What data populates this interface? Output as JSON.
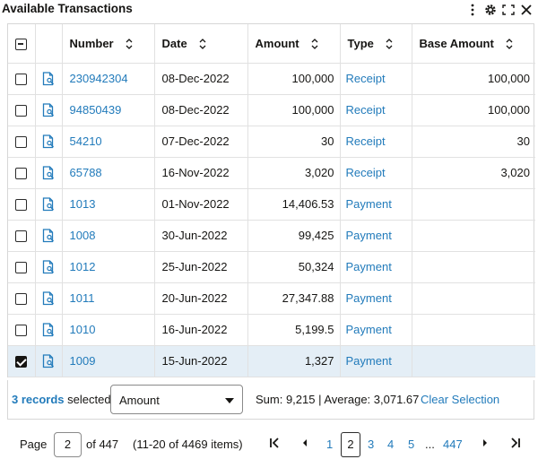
{
  "title": "Available Transactions",
  "title_icons": [
    "more-icon",
    "gear-icon",
    "expand-icon",
    "close-icon"
  ],
  "columns": {
    "number": "Number",
    "date": "Date",
    "amount": "Amount",
    "type": "Type",
    "base_amount": "Base Amount"
  },
  "rows": [
    {
      "number": "230942304",
      "date": "08-Dec-2022",
      "amount": "100,000",
      "type": "Receipt",
      "base_amount": "100,000",
      "checked": false
    },
    {
      "number": "94850439",
      "date": "08-Dec-2022",
      "amount": "100,000",
      "type": "Receipt",
      "base_amount": "100,000",
      "checked": false
    },
    {
      "number": "54210",
      "date": "07-Dec-2022",
      "amount": "30",
      "type": "Receipt",
      "base_amount": "30",
      "checked": false
    },
    {
      "number": "65788",
      "date": "16-Nov-2022",
      "amount": "3,020",
      "type": "Receipt",
      "base_amount": "3,020",
      "checked": false
    },
    {
      "number": "1013",
      "date": "01-Nov-2022",
      "amount": "14,406.53",
      "type": "Payment",
      "base_amount": "",
      "checked": false
    },
    {
      "number": "1008",
      "date": "30-Jun-2022",
      "amount": "99,425",
      "type": "Payment",
      "base_amount": "",
      "checked": false
    },
    {
      "number": "1012",
      "date": "25-Jun-2022",
      "amount": "50,324",
      "type": "Payment",
      "base_amount": "",
      "checked": false
    },
    {
      "number": "1011",
      "date": "20-Jun-2022",
      "amount": "27,347.88",
      "type": "Payment",
      "base_amount": "",
      "checked": false
    },
    {
      "number": "1010",
      "date": "16-Jun-2022",
      "amount": "5,199.5",
      "type": "Payment",
      "base_amount": "",
      "checked": false
    },
    {
      "number": "1009",
      "date": "15-Jun-2022",
      "amount": "1,327",
      "type": "Payment",
      "base_amount": "",
      "checked": true
    }
  ],
  "selection": {
    "count_label": "3 records",
    "selected_label": " selected",
    "aggregate_field": "Amount",
    "aggregate_text": "Sum: 9,215 | Average: 3,071.67",
    "clear_label": "Clear Selection"
  },
  "pagination": {
    "page_label": "Page",
    "current_page": "2",
    "of_label": "of 447",
    "range_label": "(11-20 of 4469 items)",
    "pages": [
      "1",
      "2",
      "3",
      "4",
      "5"
    ],
    "ellipsis": "...",
    "last_page": "447"
  },
  "colors": {
    "link": "#227bbb",
    "selected_row": "#e4eef6"
  }
}
